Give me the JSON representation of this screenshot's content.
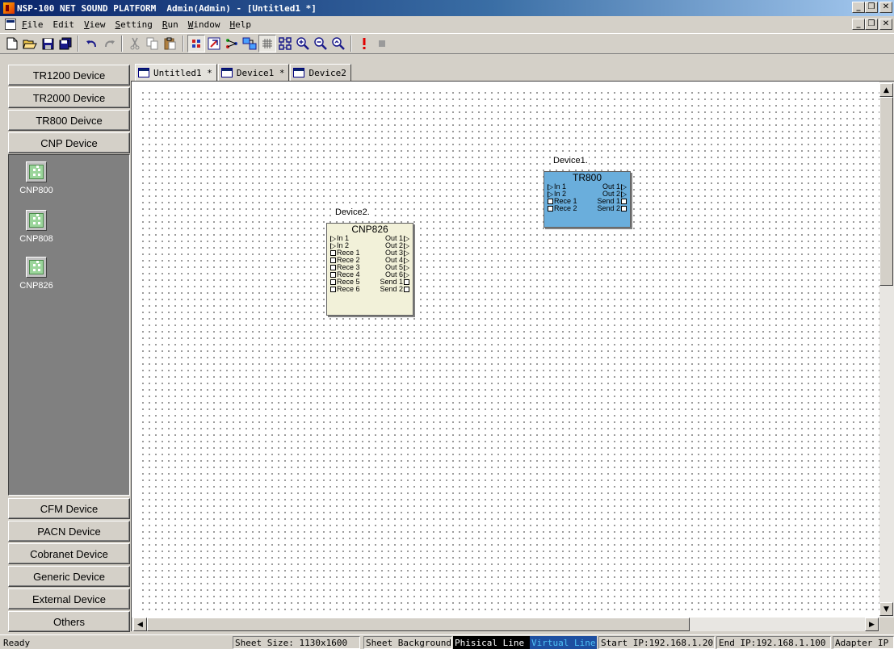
{
  "window": {
    "title": "NSP-100 NET SOUND PLATFORM  Admin(Admin) - [Untitled1 *]",
    "buttons": {
      "minimize": "_",
      "restore": "❒",
      "close": "✕"
    }
  },
  "menu": {
    "items": [
      {
        "key": "F",
        "rest": "ile"
      },
      {
        "key": "E",
        "rest": "dit",
        "underline_first": false
      },
      {
        "key": "V",
        "rest": "iew"
      },
      {
        "key": "S",
        "rest": "etting"
      },
      {
        "key": "R",
        "rest": "un"
      },
      {
        "key": "W",
        "rest": "indow"
      },
      {
        "key": "H",
        "rest": "elp"
      }
    ]
  },
  "toolbar": {
    "icons": [
      "new-file-icon",
      "open-folder-icon",
      "save-icon",
      "save-all-icon",
      "undo-icon",
      "redo-icon",
      "cut-icon",
      "copy-icon",
      "paste-icon",
      "select-device-icon",
      "drag-line-icon",
      "connect-icon",
      "group-icon",
      "grid-icon",
      "align-icon",
      "zoom-in-icon",
      "zoom-out-icon",
      "zoom-fit-icon",
      "run-icon",
      "stop-icon"
    ]
  },
  "sidebar": {
    "top_categories": [
      "TR1200 Device",
      "TR2000 Device",
      "TR800 Deivce",
      "CNP Device"
    ],
    "devices": [
      {
        "label": "CNP800"
      },
      {
        "label": "CNP808"
      },
      {
        "label": "CNP826"
      }
    ],
    "bottom_categories": [
      "CFM Device",
      "PACN Device",
      "Cobranet Device",
      "Generic Device",
      "External Device",
      "Others"
    ]
  },
  "tabs": [
    {
      "label": "Untitled1 *",
      "active": true
    },
    {
      "label": "Device1 *",
      "active": false
    },
    {
      "label": "Device2",
      "active": false
    }
  ],
  "canvas": {
    "blocks": [
      {
        "name": "Device1.",
        "model": "TR800",
        "color": "#6aaedc",
        "left_ports": [
          {
            "kind": "input",
            "label": "In 1"
          },
          {
            "kind": "input",
            "label": "In 2"
          },
          {
            "kind": "receive",
            "label": "Rece 1"
          },
          {
            "kind": "receive",
            "label": "Rece 2"
          }
        ],
        "right_ports": [
          {
            "kind": "output",
            "label": "Out 1"
          },
          {
            "kind": "output",
            "label": "Out 2"
          },
          {
            "kind": "send",
            "label": "Send 1"
          },
          {
            "kind": "send",
            "label": "Send 2"
          }
        ]
      },
      {
        "name": "Device2.",
        "model": "CNP826",
        "color": "#f2f1d9",
        "left_ports": [
          {
            "kind": "input",
            "label": "In 1"
          },
          {
            "kind": "input",
            "label": "In 2"
          },
          {
            "kind": "receive",
            "label": "Rece 1"
          },
          {
            "kind": "receive",
            "label": "Rece 2"
          },
          {
            "kind": "receive",
            "label": "Rece 3"
          },
          {
            "kind": "receive",
            "label": "Rece 4"
          },
          {
            "kind": "receive",
            "label": "Rece 5"
          },
          {
            "kind": "receive",
            "label": "Rece 6"
          }
        ],
        "right_ports": [
          {
            "kind": "output",
            "label": "Out 1"
          },
          {
            "kind": "output",
            "label": "Out 2"
          },
          {
            "kind": "output",
            "label": "Out 3"
          },
          {
            "kind": "output",
            "label": "Out 4"
          },
          {
            "kind": "output",
            "label": "Out 5"
          },
          {
            "kind": "output",
            "label": "Out 6"
          },
          {
            "kind": "send",
            "label": "Send 1"
          },
          {
            "kind": "send",
            "label": "Send 2"
          }
        ]
      }
    ]
  },
  "statusbar": {
    "ready": "Ready",
    "sheet_size": "Sheet Size: 1130x1600",
    "sheet_background": "Sheet Background",
    "physical_line": "Phisical Line",
    "virtual_line": "Virtual Line",
    "start_ip": "Start IP:192.168.1.20",
    "end_ip": "End IP:192.168.1.100",
    "adapter_ip": "Adapter IP"
  },
  "colors": {
    "titlebar_start": "#0a246a",
    "physical_line_bg": "#000000",
    "virtual_line_bg": "#1e4fa0",
    "virtual_line_text": "#4fc3f7"
  }
}
